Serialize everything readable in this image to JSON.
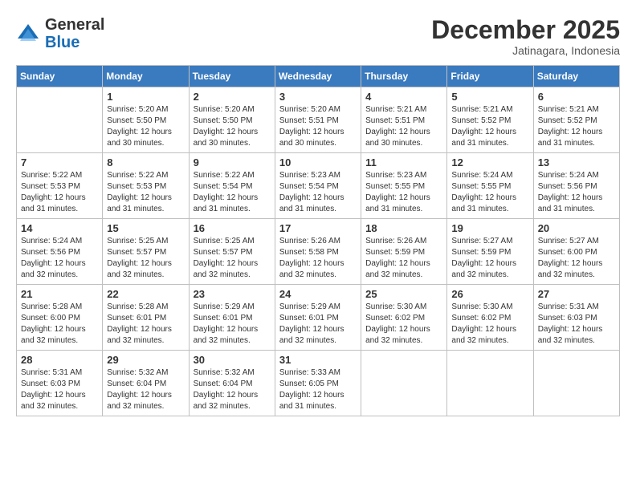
{
  "header": {
    "logo_line1": "General",
    "logo_line2": "Blue",
    "month": "December 2025",
    "location": "Jatinagara, Indonesia"
  },
  "days_of_week": [
    "Sunday",
    "Monday",
    "Tuesday",
    "Wednesday",
    "Thursday",
    "Friday",
    "Saturday"
  ],
  "weeks": [
    [
      {
        "day": "",
        "sunrise": "",
        "sunset": "",
        "daylight": ""
      },
      {
        "day": "1",
        "sunrise": "Sunrise: 5:20 AM",
        "sunset": "Sunset: 5:50 PM",
        "daylight": "Daylight: 12 hours and 30 minutes."
      },
      {
        "day": "2",
        "sunrise": "Sunrise: 5:20 AM",
        "sunset": "Sunset: 5:50 PM",
        "daylight": "Daylight: 12 hours and 30 minutes."
      },
      {
        "day": "3",
        "sunrise": "Sunrise: 5:20 AM",
        "sunset": "Sunset: 5:51 PM",
        "daylight": "Daylight: 12 hours and 30 minutes."
      },
      {
        "day": "4",
        "sunrise": "Sunrise: 5:21 AM",
        "sunset": "Sunset: 5:51 PM",
        "daylight": "Daylight: 12 hours and 30 minutes."
      },
      {
        "day": "5",
        "sunrise": "Sunrise: 5:21 AM",
        "sunset": "Sunset: 5:52 PM",
        "daylight": "Daylight: 12 hours and 31 minutes."
      },
      {
        "day": "6",
        "sunrise": "Sunrise: 5:21 AM",
        "sunset": "Sunset: 5:52 PM",
        "daylight": "Daylight: 12 hours and 31 minutes."
      }
    ],
    [
      {
        "day": "7",
        "sunrise": "Sunrise: 5:22 AM",
        "sunset": "Sunset: 5:53 PM",
        "daylight": "Daylight: 12 hours and 31 minutes."
      },
      {
        "day": "8",
        "sunrise": "Sunrise: 5:22 AM",
        "sunset": "Sunset: 5:53 PM",
        "daylight": "Daylight: 12 hours and 31 minutes."
      },
      {
        "day": "9",
        "sunrise": "Sunrise: 5:22 AM",
        "sunset": "Sunset: 5:54 PM",
        "daylight": "Daylight: 12 hours and 31 minutes."
      },
      {
        "day": "10",
        "sunrise": "Sunrise: 5:23 AM",
        "sunset": "Sunset: 5:54 PM",
        "daylight": "Daylight: 12 hours and 31 minutes."
      },
      {
        "day": "11",
        "sunrise": "Sunrise: 5:23 AM",
        "sunset": "Sunset: 5:55 PM",
        "daylight": "Daylight: 12 hours and 31 minutes."
      },
      {
        "day": "12",
        "sunrise": "Sunrise: 5:24 AM",
        "sunset": "Sunset: 5:55 PM",
        "daylight": "Daylight: 12 hours and 31 minutes."
      },
      {
        "day": "13",
        "sunrise": "Sunrise: 5:24 AM",
        "sunset": "Sunset: 5:56 PM",
        "daylight": "Daylight: 12 hours and 31 minutes."
      }
    ],
    [
      {
        "day": "14",
        "sunrise": "Sunrise: 5:24 AM",
        "sunset": "Sunset: 5:56 PM",
        "daylight": "Daylight: 12 hours and 32 minutes."
      },
      {
        "day": "15",
        "sunrise": "Sunrise: 5:25 AM",
        "sunset": "Sunset: 5:57 PM",
        "daylight": "Daylight: 12 hours and 32 minutes."
      },
      {
        "day": "16",
        "sunrise": "Sunrise: 5:25 AM",
        "sunset": "Sunset: 5:57 PM",
        "daylight": "Daylight: 12 hours and 32 minutes."
      },
      {
        "day": "17",
        "sunrise": "Sunrise: 5:26 AM",
        "sunset": "Sunset: 5:58 PM",
        "daylight": "Daylight: 12 hours and 32 minutes."
      },
      {
        "day": "18",
        "sunrise": "Sunrise: 5:26 AM",
        "sunset": "Sunset: 5:59 PM",
        "daylight": "Daylight: 12 hours and 32 minutes."
      },
      {
        "day": "19",
        "sunrise": "Sunrise: 5:27 AM",
        "sunset": "Sunset: 5:59 PM",
        "daylight": "Daylight: 12 hours and 32 minutes."
      },
      {
        "day": "20",
        "sunrise": "Sunrise: 5:27 AM",
        "sunset": "Sunset: 6:00 PM",
        "daylight": "Daylight: 12 hours and 32 minutes."
      }
    ],
    [
      {
        "day": "21",
        "sunrise": "Sunrise: 5:28 AM",
        "sunset": "Sunset: 6:00 PM",
        "daylight": "Daylight: 12 hours and 32 minutes."
      },
      {
        "day": "22",
        "sunrise": "Sunrise: 5:28 AM",
        "sunset": "Sunset: 6:01 PM",
        "daylight": "Daylight: 12 hours and 32 minutes."
      },
      {
        "day": "23",
        "sunrise": "Sunrise: 5:29 AM",
        "sunset": "Sunset: 6:01 PM",
        "daylight": "Daylight: 12 hours and 32 minutes."
      },
      {
        "day": "24",
        "sunrise": "Sunrise: 5:29 AM",
        "sunset": "Sunset: 6:01 PM",
        "daylight": "Daylight: 12 hours and 32 minutes."
      },
      {
        "day": "25",
        "sunrise": "Sunrise: 5:30 AM",
        "sunset": "Sunset: 6:02 PM",
        "daylight": "Daylight: 12 hours and 32 minutes."
      },
      {
        "day": "26",
        "sunrise": "Sunrise: 5:30 AM",
        "sunset": "Sunset: 6:02 PM",
        "daylight": "Daylight: 12 hours and 32 minutes."
      },
      {
        "day": "27",
        "sunrise": "Sunrise: 5:31 AM",
        "sunset": "Sunset: 6:03 PM",
        "daylight": "Daylight: 12 hours and 32 minutes."
      }
    ],
    [
      {
        "day": "28",
        "sunrise": "Sunrise: 5:31 AM",
        "sunset": "Sunset: 6:03 PM",
        "daylight": "Daylight: 12 hours and 32 minutes."
      },
      {
        "day": "29",
        "sunrise": "Sunrise: 5:32 AM",
        "sunset": "Sunset: 6:04 PM",
        "daylight": "Daylight: 12 hours and 32 minutes."
      },
      {
        "day": "30",
        "sunrise": "Sunrise: 5:32 AM",
        "sunset": "Sunset: 6:04 PM",
        "daylight": "Daylight: 12 hours and 32 minutes."
      },
      {
        "day": "31",
        "sunrise": "Sunrise: 5:33 AM",
        "sunset": "Sunset: 6:05 PM",
        "daylight": "Daylight: 12 hours and 31 minutes."
      },
      {
        "day": "",
        "sunrise": "",
        "sunset": "",
        "daylight": ""
      },
      {
        "day": "",
        "sunrise": "",
        "sunset": "",
        "daylight": ""
      },
      {
        "day": "",
        "sunrise": "",
        "sunset": "",
        "daylight": ""
      }
    ]
  ]
}
